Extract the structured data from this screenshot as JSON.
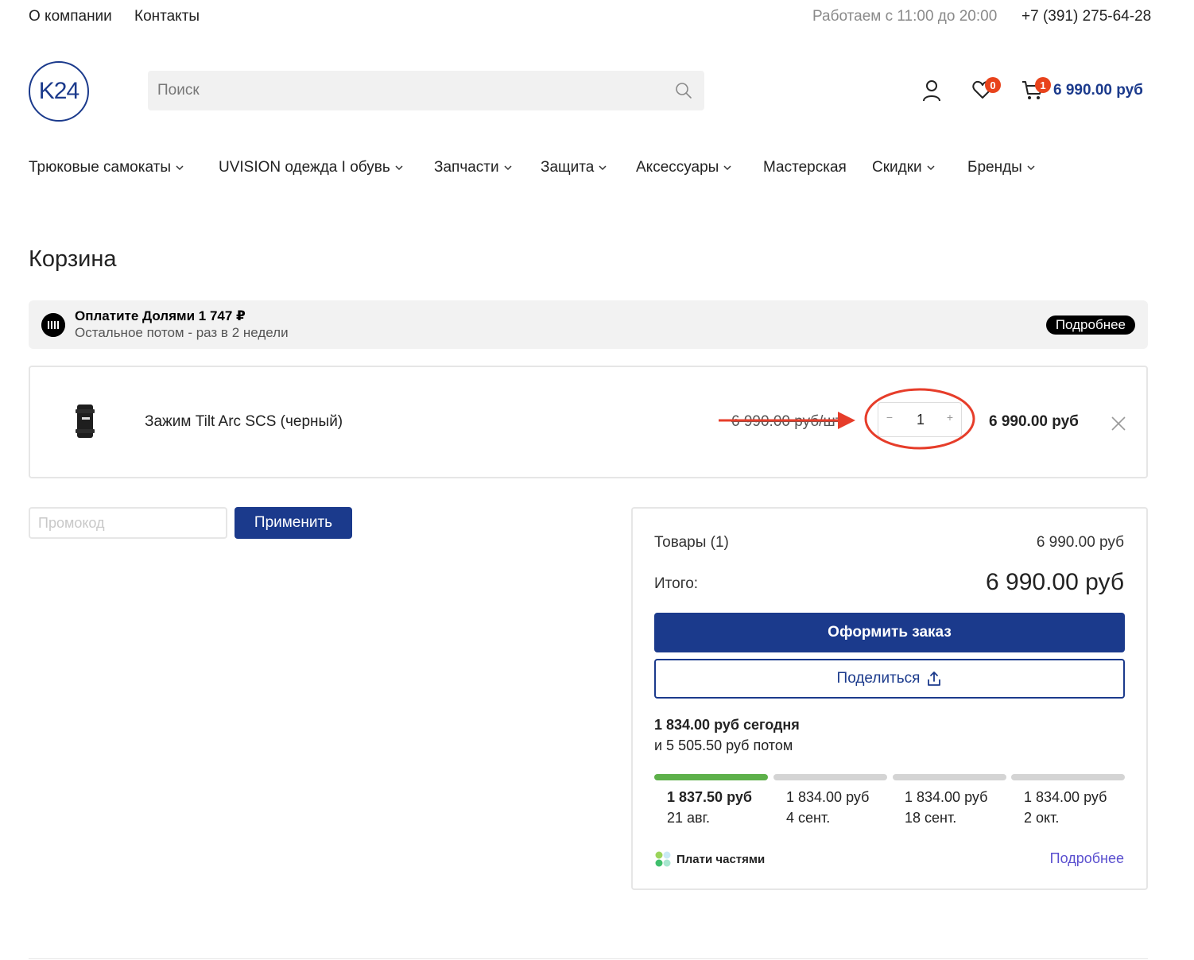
{
  "topbar": {
    "about": "О компании",
    "contacts": "Контакты",
    "hours": "Работаем с 11:00 до 20:00",
    "phone": "+7 (391) 275-64-28"
  },
  "header": {
    "logo_text": "K24",
    "search_placeholder": "Поиск",
    "favorites_count": "0",
    "cart_count": "1",
    "cart_total": "6 990.00 руб",
    "brand_color": "#1b3a8c",
    "badge_color": "#e8431c"
  },
  "menu": [
    {
      "label": "Трюковые самокаты",
      "dropdown": true
    },
    {
      "label": "UVISION одежда I обувь",
      "dropdown": true
    },
    {
      "label": "Запчасти",
      "dropdown": true
    },
    {
      "label": "Защита",
      "dropdown": true
    },
    {
      "label": "Аксессуары",
      "dropdown": true
    },
    {
      "label": "Мастерская",
      "dropdown": false
    },
    {
      "label": "Скидки",
      "dropdown": true
    },
    {
      "label": "Бренды",
      "dropdown": true
    }
  ],
  "page_title": "Корзина",
  "dolyami": {
    "title": "Оплатите Долями 1 747 ₽",
    "subtitle": "Остальное потом - раз в 2 недели",
    "more": "Подробнее"
  },
  "cart_item": {
    "name": "Зажим Tilt Arc SCS (черный)",
    "unit_price": "6 990.00 руб/шт",
    "quantity": "1",
    "minus": "−",
    "plus": "+",
    "price": "6 990.00 руб"
  },
  "promo": {
    "placeholder": "Промокод",
    "apply": "Применить"
  },
  "summary": {
    "goods_label": "Товары (1)",
    "goods_value": "6 990.00 руб",
    "total_label": "Итого:",
    "total_value": "6 990.00 руб",
    "order_button": "Оформить заказ",
    "share_button": "Поделиться",
    "pay_today": "1 834.00 руб сегодня",
    "pay_later": "и 5 505.50 руб потом",
    "installments": [
      {
        "amount": "1 837.50 руб",
        "date": "21 авг.",
        "active": true
      },
      {
        "amount": "1 834.00 руб",
        "date": "4 сент.",
        "active": false
      },
      {
        "amount": "1 834.00 руб",
        "date": "18 сент.",
        "active": false
      },
      {
        "amount": "1 834.00 руб",
        "date": "2 окт.",
        "active": false
      }
    ],
    "plati_label": "Плати частями",
    "more_link": "Подробнее"
  }
}
